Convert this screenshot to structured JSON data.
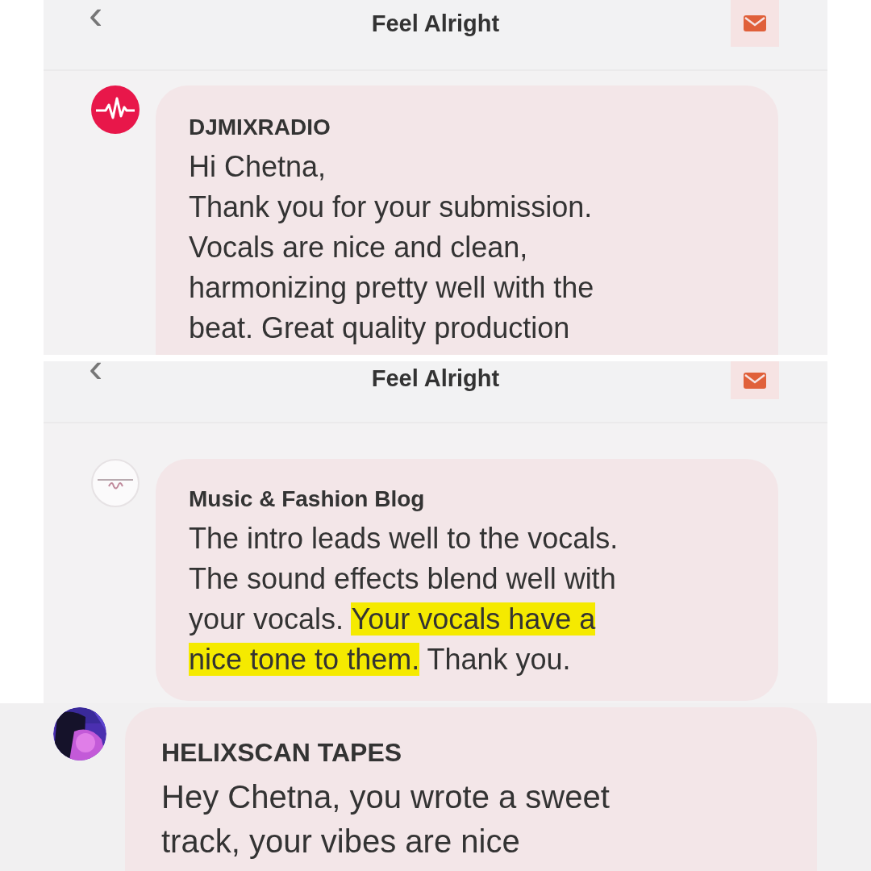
{
  "panels": [
    {
      "header": {
        "back": "‹",
        "title": "Feel Alright"
      },
      "message": {
        "avatar": {
          "kind": "pulse"
        },
        "sender": "DJMIXRADIO",
        "segments": [
          {
            "text": "Hi Chetna,\nThank you for your submission.\nVocals are nice and clean,\nharmonizing pretty well with the\nbeat. Great quality production",
            "highlighted": false
          }
        ]
      }
    },
    {
      "header": {
        "back": "‹",
        "title": "Feel Alright"
      },
      "message": {
        "avatar": {
          "kind": "logo"
        },
        "sender": "Music & Fashion Blog",
        "segments": [
          {
            "text": "The intro leads well to the vocals.\nThe sound effects blend well with\nyour vocals. ",
            "highlighted": false
          },
          {
            "text": "Your vocals have a\nnice tone to them.",
            "highlighted": true
          },
          {
            "text": " Thank you.",
            "highlighted": false
          }
        ]
      }
    },
    {
      "message": {
        "sender": "HELIXSCAN TAPES",
        "segments": [
          {
            "text": "Hey Chetna, you wrote a sweet\ntrack, your vibes are nice",
            "highlighted": false
          }
        ]
      }
    }
  ]
}
